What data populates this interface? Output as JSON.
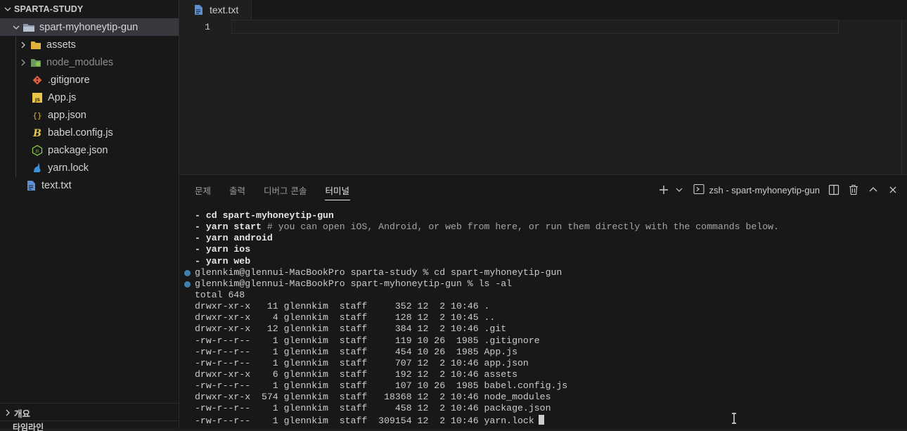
{
  "explorer": {
    "root_label": "SPARTA-STUDY",
    "items": [
      {
        "label": "spart-myhoneytip-gun",
        "icon": "folder-open-icon"
      },
      {
        "label": "assets",
        "icon": "folder-icon"
      },
      {
        "label": "node_modules",
        "icon": "node-folder-icon"
      },
      {
        "label": ".gitignore",
        "icon": "git-icon"
      },
      {
        "label": "App.js",
        "icon": "js-file-icon"
      },
      {
        "label": "app.json",
        "icon": "json-file-icon"
      },
      {
        "label": "babel.config.js",
        "icon": "babel-icon"
      },
      {
        "label": "package.json",
        "icon": "node-js-icon"
      },
      {
        "label": "yarn.lock",
        "icon": "yarn-icon"
      },
      {
        "label": "text.txt",
        "icon": "text-file-icon"
      }
    ],
    "outline_label": "개요",
    "timeline_label": "타임라인"
  },
  "editor": {
    "tab_label": "text.txt",
    "line_number": "1"
  },
  "panel": {
    "tabs": [
      "문제",
      "출력",
      "디버그 콘솔",
      "터미널"
    ],
    "active_tab": "터미널",
    "terminal_name": "zsh - spart-myhoneytip-gun"
  },
  "terminal": {
    "hint_lines": [
      {
        "cmd": "- cd spart-myhoneytip-gun",
        "comment": ""
      },
      {
        "cmd": "- yarn start",
        "comment": " # you can open iOS, Android, or web from here, or run them directly with the commands below."
      },
      {
        "cmd": "- yarn android",
        "comment": ""
      },
      {
        "cmd": "- yarn ios",
        "comment": ""
      },
      {
        "cmd": "- yarn web",
        "comment": ""
      }
    ],
    "prompt_lines": [
      "glennkim@glennui-MacBookPro sparta-study % cd spart-myhoneytip-gun",
      "glennkim@glennui-MacBookPro spart-myhoneytip-gun % ls -al"
    ],
    "total_line": "total 648",
    "listing": [
      "drwxr-xr-x   11 glennkim  staff     352 12  2 10:46 .",
      "drwxr-xr-x    4 glennkim  staff     128 12  2 10:45 ..",
      "drwxr-xr-x   12 glennkim  staff     384 12  2 10:46 .git",
      "-rw-r--r--    1 glennkim  staff     119 10 26  1985 .gitignore",
      "-rw-r--r--    1 glennkim  staff     454 10 26  1985 App.js",
      "-rw-r--r--    1 glennkim  staff     707 12  2 10:46 app.json",
      "drwxr-xr-x    6 glennkim  staff     192 12  2 10:46 assets",
      "-rw-r--r--    1 glennkim  staff     107 10 26  1985 babel.config.js",
      "drwxr-xr-x  574 glennkim  staff   18368 12  2 10:46 node_modules",
      "-rw-r--r--    1 glennkim  staff     458 12  2 10:46 package.json",
      "-rw-r--r--    1 glennkim  staff  309154 12  2 10:46 yarn.lock"
    ]
  }
}
